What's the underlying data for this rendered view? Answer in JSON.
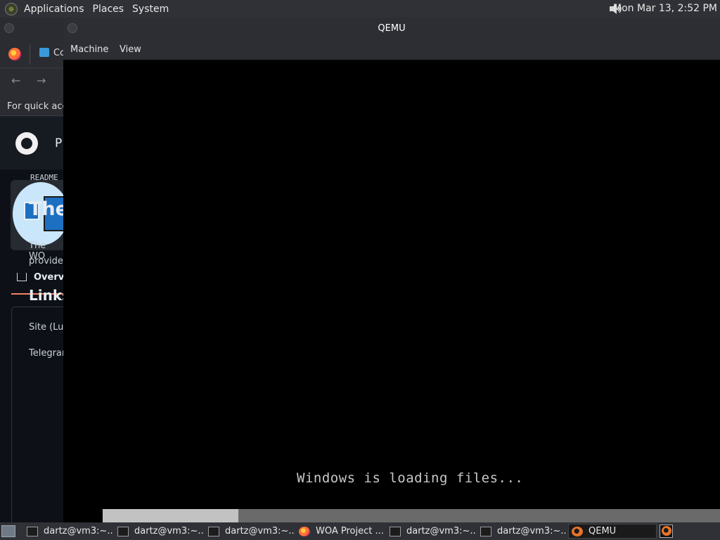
{
  "top_panel": {
    "menus": [
      "Applications",
      "Places",
      "System"
    ],
    "clock": "Mon Mar 13,  2:52 PM"
  },
  "browser": {
    "tab_label": "Co",
    "bookmark_hint": "For quick acce",
    "github_title": "P",
    "overview_tab": "Overvi",
    "readme_label": "README",
    "readme_heading": "The",
    "readme_para_line1": "The WO",
    "readme_para_line2": "provide",
    "links_heading": "Links",
    "link1": "Site (Lu",
    "link2": "Telegrar"
  },
  "qemu": {
    "title": "QEMU",
    "menus": [
      "Machine",
      "View"
    ],
    "screen_text": "Windows is loading files..."
  },
  "taskbar": {
    "tasks": [
      {
        "label": "dartz@vm3:~...",
        "icon": "terminal-icon"
      },
      {
        "label": "dartz@vm3:~...",
        "icon": "terminal-icon"
      },
      {
        "label": "dartz@vm3:~...",
        "icon": "terminal-icon"
      },
      {
        "label": "WOA Project ...",
        "icon": "firefox-icon"
      },
      {
        "label": "dartz@vm3:~...",
        "icon": "terminal-icon"
      },
      {
        "label": "dartz@vm3:~...",
        "icon": "terminal-icon"
      },
      {
        "label": "QEMU",
        "icon": "qemu-icon"
      }
    ]
  }
}
